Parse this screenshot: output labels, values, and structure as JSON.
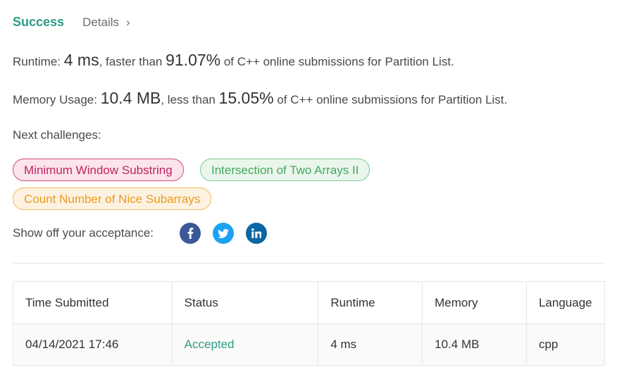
{
  "header": {
    "status_title": "Success",
    "details_label": "Details",
    "details_chevron": "›"
  },
  "runtime": {
    "label": "Runtime: ",
    "value": "4 ms",
    "middle": ", faster than ",
    "percent": "91.07%",
    "suffix": " of C++ online submissions for Partition List."
  },
  "memory": {
    "label": "Memory Usage: ",
    "value": "10.4 MB",
    "middle": ", less than ",
    "percent": "15.05%",
    "suffix": " of C++ online submissions for Partition List."
  },
  "next_challenges": {
    "label": "Next challenges:",
    "items": [
      {
        "title": "Minimum Window Substring",
        "difficulty_color": "#c0245f"
      },
      {
        "title": "Intersection of Two Arrays II",
        "difficulty_color": "#45a85e"
      },
      {
        "title": "Count Number of Nice Subarrays",
        "difficulty_color": "#ec9b1d"
      }
    ]
  },
  "share": {
    "label": "Show off your acceptance:",
    "icons": [
      "facebook-icon",
      "twitter-icon",
      "linkedin-icon"
    ]
  },
  "submissions": {
    "columns": [
      "Time Submitted",
      "Status",
      "Runtime",
      "Memory",
      "Language"
    ],
    "rows": [
      {
        "time": "04/14/2021 17:46",
        "status": "Accepted",
        "runtime": "4 ms",
        "memory": "10.4 MB",
        "language": "cpp"
      }
    ]
  },
  "colors": {
    "accent": "#2e9c85",
    "facebook": "#3b5998",
    "twitter": "#1da1f2",
    "linkedin": "#0a66a2"
  }
}
